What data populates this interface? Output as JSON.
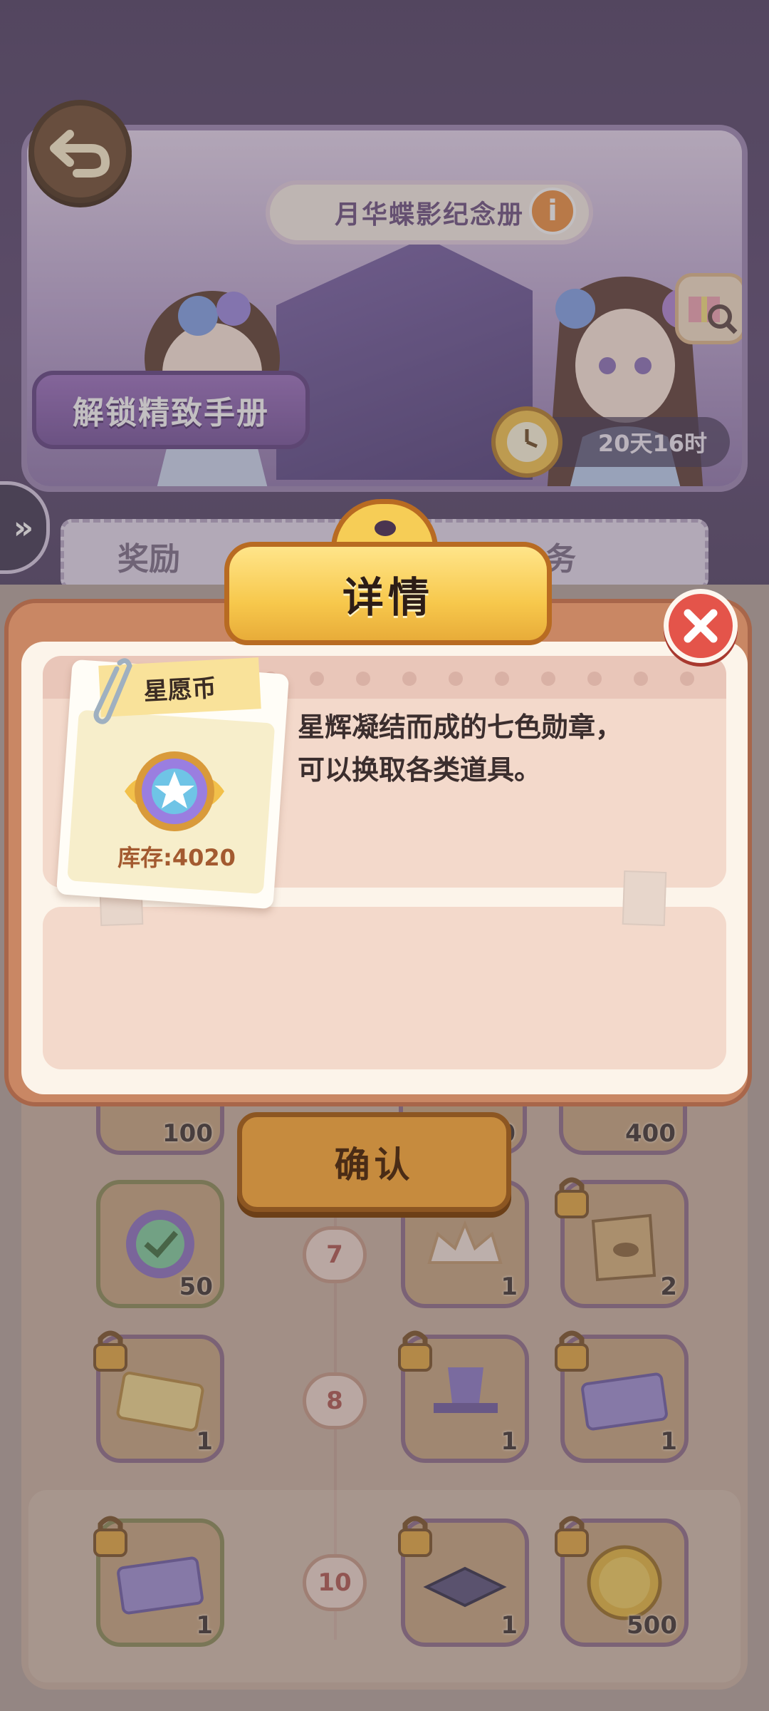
{
  "banner": {
    "title": "月华蝶影纪念册",
    "unlock_label": "解锁精致手册",
    "timer": "20天16时"
  },
  "reward_strip": {
    "left_text": "奖励",
    "right_text": "务"
  },
  "dialog": {
    "title": "详情",
    "item_name": "星愿币",
    "stock": "库存:4020",
    "description_line1": "星辉凝结而成的七色勋章，",
    "description_line2": "可以换取各类道具。",
    "confirm_label": "确认"
  },
  "rows": [
    {
      "level": "7",
      "left": "50",
      "mid": "1",
      "right": "2"
    },
    {
      "level": "8",
      "left": "1",
      "mid": "1",
      "right": "1"
    },
    {
      "level": "10",
      "left": "1",
      "mid": "1",
      "right": "500"
    }
  ],
  "top_row_counts": {
    "left": "100",
    "mid": "0",
    "right": "400"
  },
  "colors": {
    "accent": "#f7c84c",
    "close": "#e4544a",
    "dialog_frame": "#c98764"
  }
}
